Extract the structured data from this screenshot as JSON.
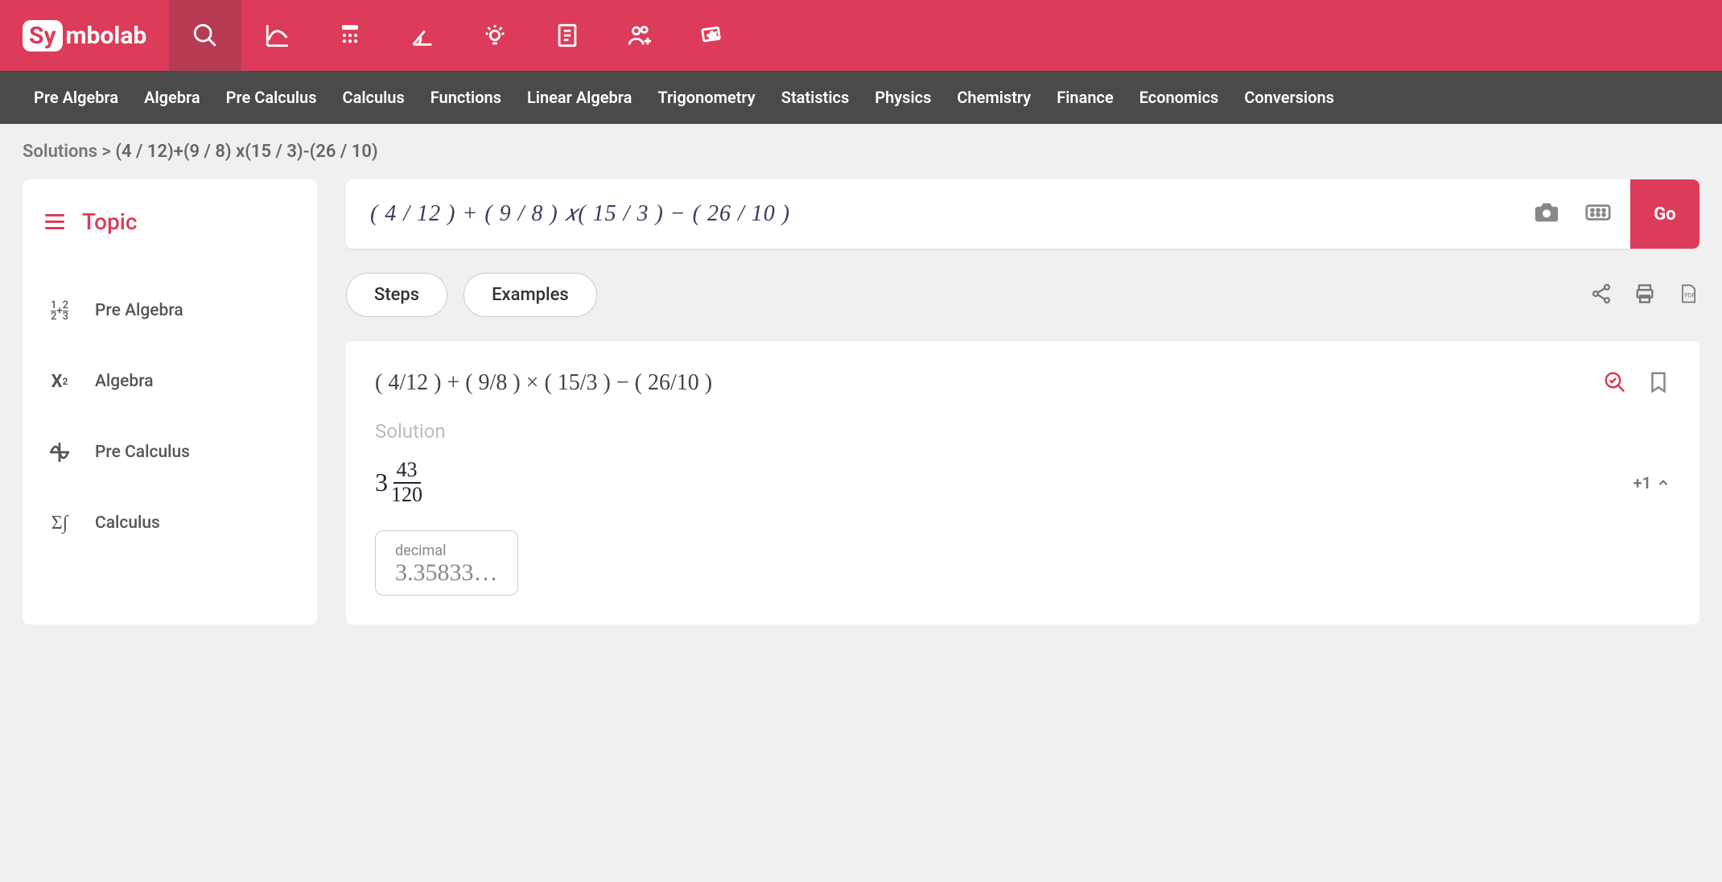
{
  "brand": {
    "prefix": "Sy",
    "suffix": "mbolab"
  },
  "subnav": {
    "items": [
      "Pre Algebra",
      "Algebra",
      "Pre Calculus",
      "Calculus",
      "Functions",
      "Linear Algebra",
      "Trigonometry",
      "Statistics",
      "Physics",
      "Chemistry",
      "Finance",
      "Economics",
      "Conversions"
    ]
  },
  "breadcrumb": {
    "root": "Solutions",
    "sep": ">",
    "expr": "(4 / 12)+(9 / 8) x(15 / 3)-(26 / 10)"
  },
  "sidebar": {
    "header": "Topic",
    "items": [
      {
        "label": "Pre Algebra",
        "icon": "½+⅔"
      },
      {
        "label": "Algebra",
        "icon": "x²"
      },
      {
        "label": "Pre Calculus",
        "icon": "wave"
      },
      {
        "label": "Calculus",
        "icon": "Σ∫"
      }
    ]
  },
  "input": {
    "expr": "( 4 / 12 )  +  ( 9 / 8 ) 𝑥( 15 / 3 )  −  ( 26 / 10 )",
    "go": "Go"
  },
  "pills": {
    "steps": "Steps",
    "examples": "Examples"
  },
  "solution": {
    "problem": "( 4/12 ) + ( 9/8 ) × ( 15/3 ) − ( 26/10 )",
    "label": "Solution",
    "mixed_whole": "3",
    "mixed_num": "43",
    "mixed_den": "120",
    "more": "+1",
    "decimal_label": "decimal",
    "decimal_value": "3.35833…"
  }
}
